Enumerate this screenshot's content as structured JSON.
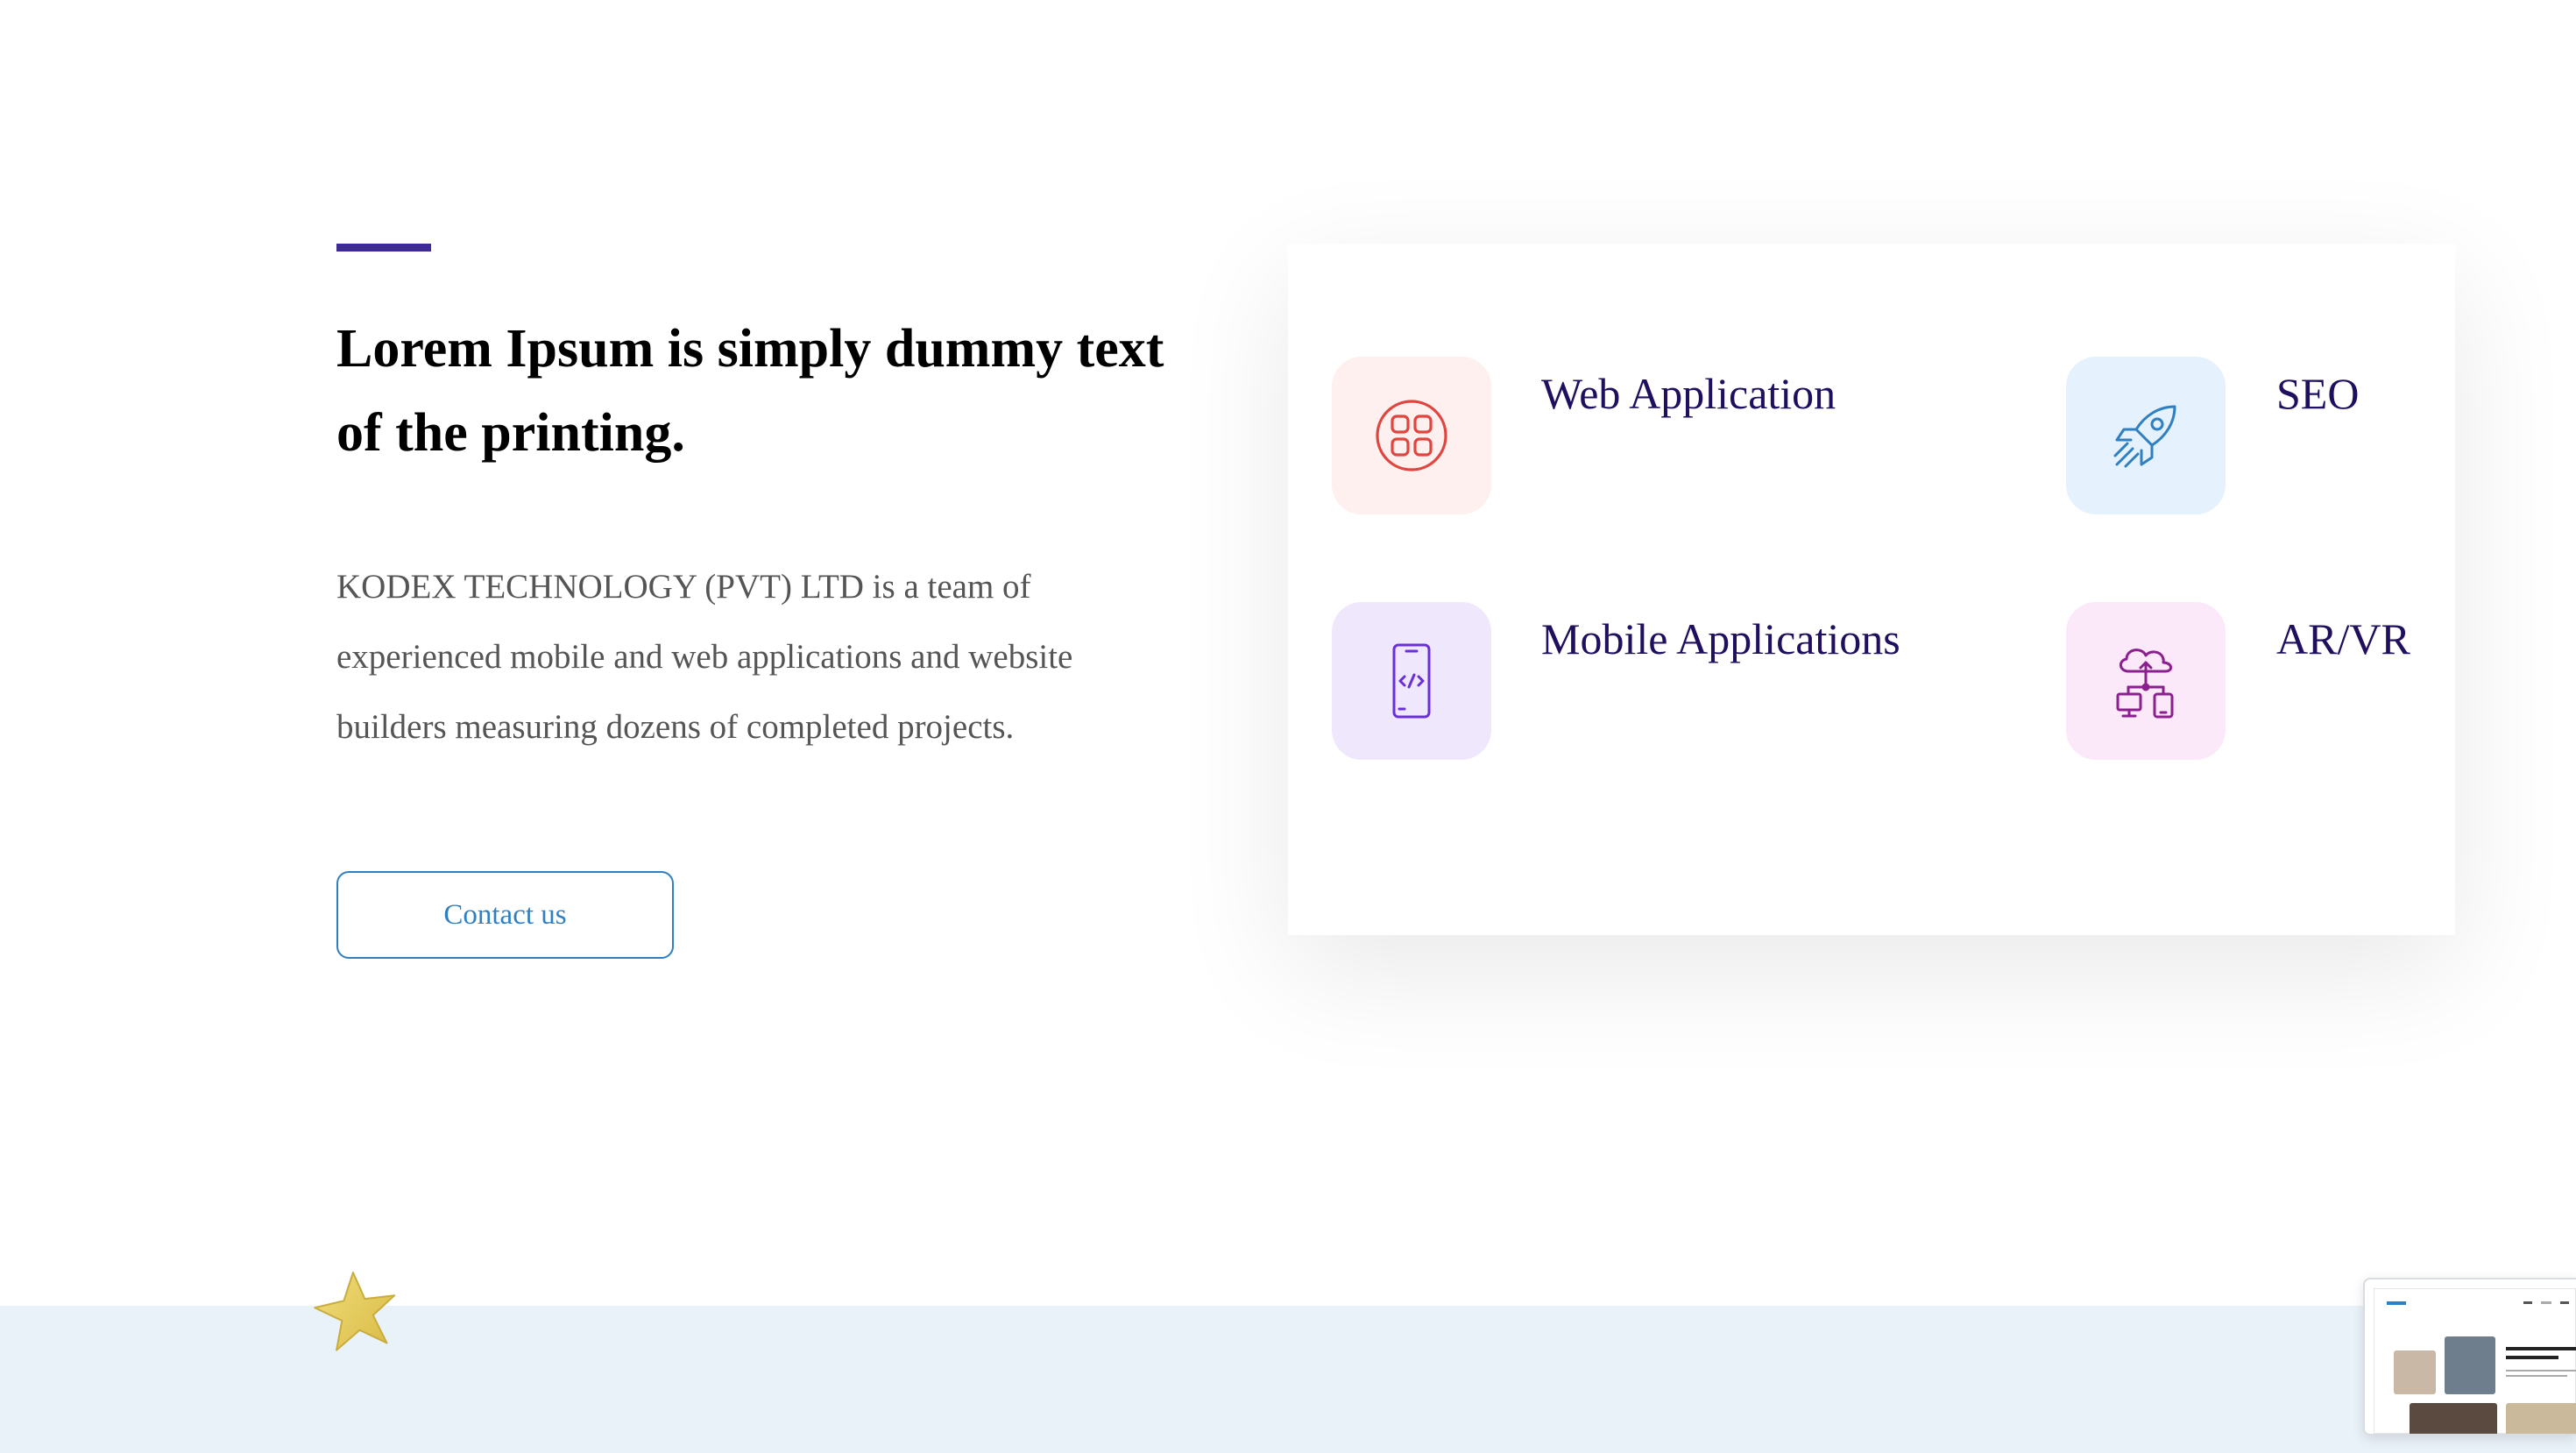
{
  "hero": {
    "headline": "Lorem Ipsum is simply dummy text of the printing.",
    "description": "KODEX TECHNOLOGY (PVT) LTD is a team of experienced mobile and web applications and website builders measuring dozens of completed projects.",
    "contact_button_label": "Contact us"
  },
  "services": [
    {
      "label": "Web Application",
      "icon": "grid-apps-icon",
      "icon_bg": "#fdf0ef",
      "icon_color": "#e0453f"
    },
    {
      "label": "SEO",
      "icon": "rocket-icon",
      "icon_bg": "#e5f1fd",
      "icon_color": "#2f7fc1"
    },
    {
      "label": "Mobile Applications",
      "icon": "mobile-code-icon",
      "icon_bg": "#efe8fc",
      "icon_color": "#6a2fd6"
    },
    {
      "label": "AR/VR",
      "icon": "cloud-devices-icon",
      "icon_bg": "#fbe8f8",
      "icon_color": "#8b1f8f"
    }
  ],
  "colors": {
    "accent": "#3f2b96",
    "button_border": "#2f7fc1",
    "service_label": "#1f0f5e",
    "bottom_band": "#eaf2f9",
    "star": "#e9cf5c"
  },
  "decor": {
    "star": "star-icon",
    "preview": "page-preview-thumbnail"
  },
  "preview_thumbnail": {
    "headline": "Lorem Ipsum is simply text of the printing."
  }
}
